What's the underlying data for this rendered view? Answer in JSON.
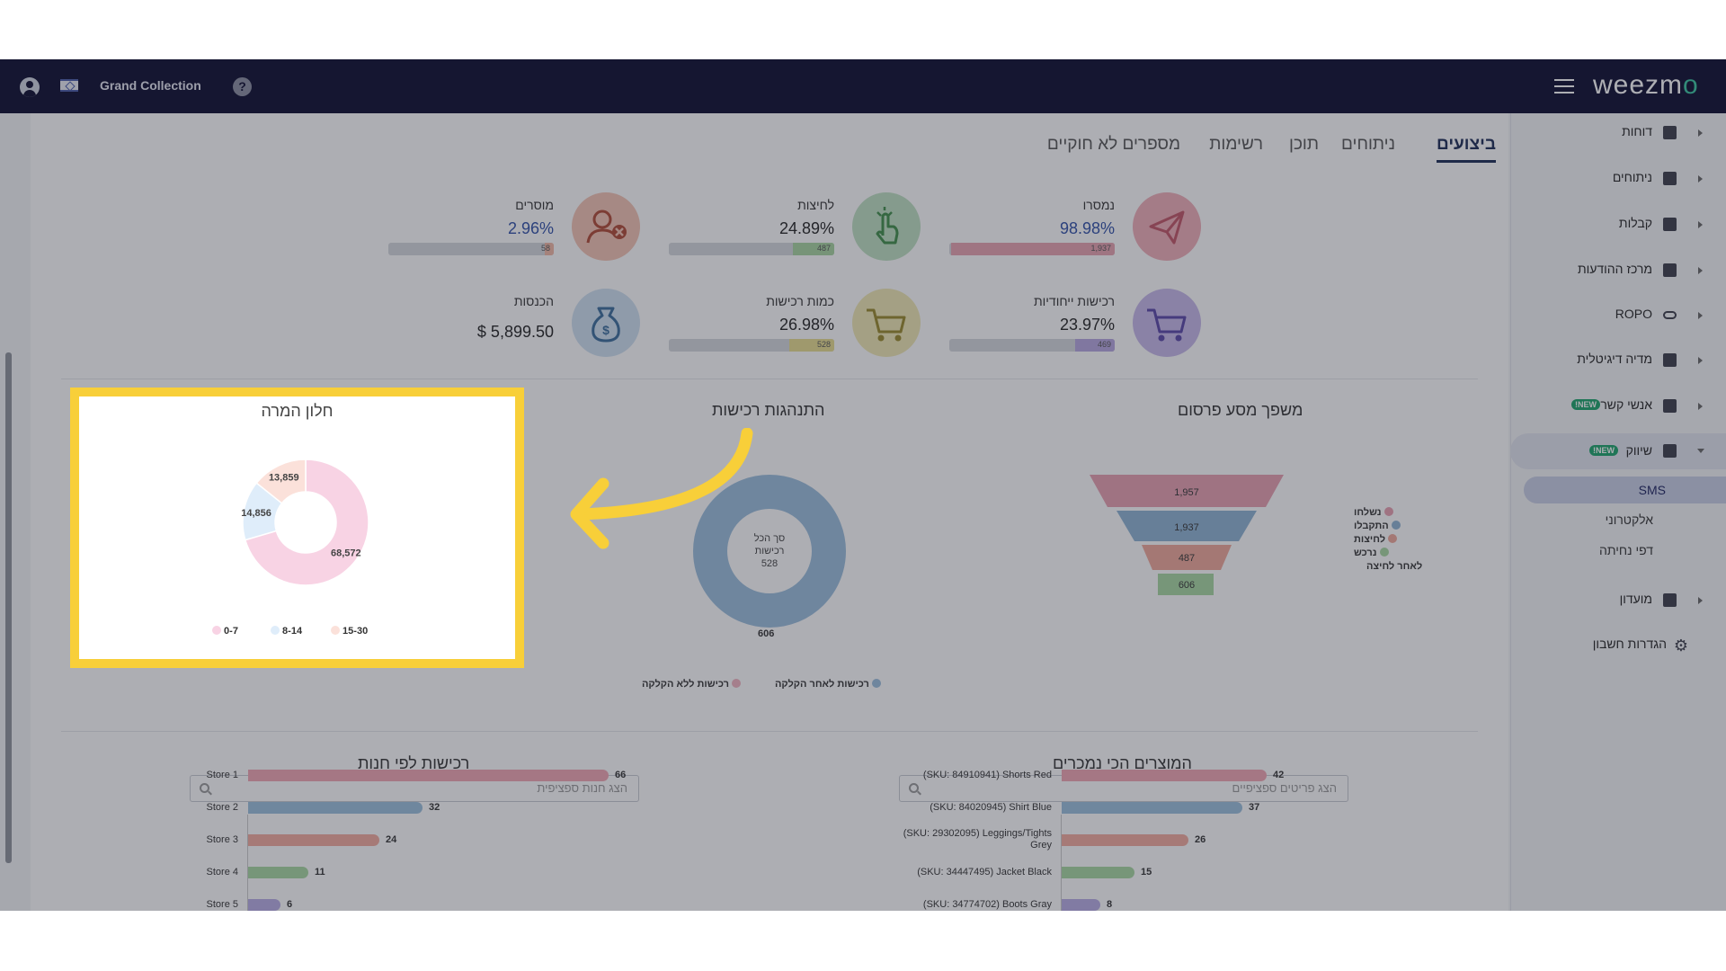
{
  "topbar": {
    "account_name": "Grand Collection",
    "help_label": "?",
    "logo_text": "weezm",
    "logo_accent": "o"
  },
  "sidebar": {
    "items": [
      {
        "label": "דוחות",
        "icon": "dashboard-icon"
      },
      {
        "label": "ניתוחים",
        "icon": "analytics-icon"
      },
      {
        "label": "קבלות",
        "icon": "receipt-icon"
      },
      {
        "label": "מרכז ההודעות",
        "icon": "message-icon"
      },
      {
        "label": "ROPO",
        "icon": "glasses-icon"
      },
      {
        "label": "מדיה דיגיטלית",
        "icon": "users-icon"
      },
      {
        "label": "אנשי קשר",
        "icon": "contacts-icon",
        "badge": "NEW!"
      },
      {
        "label": "שיווק",
        "icon": "party-popper-icon",
        "badge": "NEW!"
      },
      {
        "label": "מועדון",
        "icon": "tags-icon"
      },
      {
        "label": "הגדרות חשבון",
        "icon": "gear-icon"
      }
    ],
    "sub_items": [
      "SMS",
      "אלקטרוני",
      "דפי נחיתה"
    ]
  },
  "tabs": [
    "ביצועים",
    "ניתוחים",
    "תוכן",
    "רשימות",
    "מספרים לא חוקיים"
  ],
  "kpis": [
    {
      "title": "נמסרו",
      "value": "98.98%",
      "count": "1,937",
      "fill": 0.99,
      "color": "#f0aeb8",
      "bar_color": "#e8a3b0",
      "icon": "paper-plane-icon",
      "blue": true
    },
    {
      "title": "לחיצות",
      "value": "24.89%",
      "count": "487",
      "fill": 0.25,
      "color": "#bfe0c2",
      "bar_color": "#a8d6a0",
      "icon": "hand-pointer-icon",
      "blue": false
    },
    {
      "title": "מוסרים",
      "value": "2.96%",
      "count": "58",
      "fill": 0.03,
      "color": "#f4c3b3",
      "bar_color": "#f2b9a5",
      "icon": "user-remove-icon",
      "blue": true
    },
    {
      "title": "רכישות ייחודיות",
      "value": "23.97%",
      "count": "469",
      "fill": 0.24,
      "color": "#c7b9ea",
      "bar_color": "#b6a6e0",
      "icon": "cart-purple-icon",
      "blue": false
    },
    {
      "title": "כמות רכישות",
      "value": "26.98%",
      "count": "528",
      "fill": 0.27,
      "color": "#f0e9b4",
      "bar_color": "#e8de8f",
      "icon": "cart-yellow-icon",
      "blue": false
    },
    {
      "title": "הכנסות",
      "value": "$ 5,899.50",
      "count": "",
      "fill": 0,
      "color": "#cfe1f1",
      "bar_color": "#b4cfe8",
      "icon": "money-bag-icon",
      "blue": false
    }
  ],
  "funnel": {
    "title": "משפך מסע פרסום",
    "values": [
      "1,957",
      "1,937",
      "487",
      "606"
    ],
    "colors": [
      "#e9a0b1",
      "#8fb4d3",
      "#f0a99a",
      "#a9d9a2"
    ],
    "legend": [
      {
        "label": "נשלחו",
        "color": "#e9a0b1"
      },
      {
        "label": "התקבלו",
        "color": "#8fb4d3"
      },
      {
        "label": "לחיצות",
        "color": "#f0a99a"
      },
      {
        "label": "נרכש",
        "color": "#a9d9a2"
      },
      {
        "label": "לאחר לחיצה",
        "color": ""
      }
    ]
  },
  "purchases": {
    "title": "התנהגות רכישות",
    "center_lines": [
      "סך הכל",
      "רכישות",
      "528"
    ],
    "value": "606",
    "legend": [
      {
        "label": "רכישות לאחר הקלקה",
        "color": "#9bbedd"
      },
      {
        "label": "רכישות ללא הקלקה",
        "color": "#f2b3c0"
      }
    ]
  },
  "window": {
    "title": "חלון המרה",
    "chart_data": {
      "type": "pie",
      "donut": true,
      "categories": [
        "0-7",
        "8-14",
        "15-30"
      ],
      "values": [
        68572,
        14856,
        13859
      ],
      "labels": [
        "68,572",
        "14,856",
        "13,859"
      ],
      "colors": [
        "#f8d3e4",
        "#dfedfa",
        "#fbe1da"
      ]
    }
  },
  "stores": {
    "title": "רכישות לפי חנות",
    "search_placeholder": "הצג חנות ספציפית",
    "chart_data": {
      "type": "bar",
      "orientation": "horizontal",
      "categories": [
        "Store 1",
        "Store 2",
        "Store 3",
        "Store 4",
        "Store 5"
      ],
      "values": [
        66,
        32,
        24,
        11,
        6
      ],
      "colors": [
        "#f2a7b4",
        "#9cc0dd",
        "#f4ac9e",
        "#a9d9a2",
        "#b8ade6"
      ]
    }
  },
  "products": {
    "title": "המוצרים הכי נמכרים",
    "search_placeholder": "הצג פריטים ספציפיים",
    "chart_data": {
      "type": "bar",
      "orientation": "horizontal",
      "categories": [
        "(SKU: 84910941) Shorts Red",
        "(SKU: 84020945) Shirt Blue",
        "(SKU: 29302095) Leggings/Tights Grey",
        "(SKU: 34447495) Jacket Black",
        "(SKU: 34774702) Boots Gray"
      ],
      "values": [
        42,
        37,
        26,
        15,
        8
      ],
      "colors": [
        "#f2a7b4",
        "#9cc0dd",
        "#f4ac9e",
        "#a9d9a2",
        "#b8ade6"
      ]
    }
  }
}
